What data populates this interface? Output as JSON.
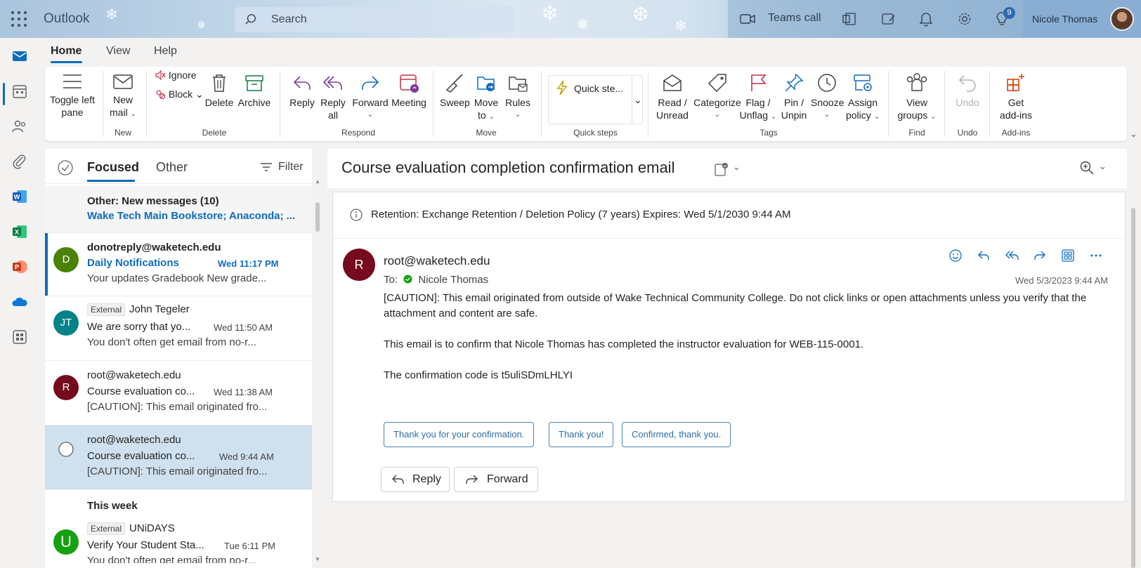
{
  "app": {
    "brand": "Outlook",
    "search_placeholder": "Search",
    "teams_call": "Teams call",
    "notification_count": "9",
    "user_name": "Nicole Thomas"
  },
  "tabs": [
    "Home",
    "View",
    "Help"
  ],
  "ribbon": {
    "toggle_left_pane": [
      "Toggle left",
      "pane"
    ],
    "new_mail": [
      "New",
      "mail"
    ],
    "ignore": "Ignore",
    "block": "Block",
    "delete": "Delete",
    "archive": "Archive",
    "reply": "Reply",
    "reply_all": [
      "Reply",
      "all"
    ],
    "forward": "Forward",
    "meeting": "Meeting",
    "sweep": "Sweep",
    "move_to": [
      "Move",
      "to"
    ],
    "rules": "Rules",
    "quick_steps": "Quick ste...",
    "read_unread": [
      "Read /",
      "Unread"
    ],
    "categorize": "Categorize",
    "flag_unflag": [
      "Flag /",
      "Unflag"
    ],
    "pin_unpin": [
      "Pin /",
      "Unpin"
    ],
    "snooze": "Snooze",
    "assign_policy": [
      "Assign",
      "policy"
    ],
    "view_groups": [
      "View",
      "groups"
    ],
    "undo": "Undo",
    "get_addins": [
      "Get",
      "add-ins"
    ],
    "groups": {
      "new": "New",
      "delete": "Delete",
      "respond": "Respond",
      "move": "Move",
      "quick_steps": "Quick steps",
      "tags": "Tags",
      "find": "Find",
      "undo": "Undo",
      "addins": "Add-ins"
    }
  },
  "list": {
    "focused": "Focused",
    "other": "Other",
    "filter": "Filter",
    "other_banner": {
      "title": "Other: New messages (10)",
      "senders": "Wake Tech Main Bookstore; Anaconda; ..."
    },
    "week_header": "This week",
    "items": [
      {
        "initials": "D",
        "sender": "donotreply@waketech.edu",
        "subject": "Daily Notifications",
        "time": "Wed 11:17 PM",
        "preview": "Your updates Gradebook New grade..."
      },
      {
        "initials": "JT",
        "external": "External",
        "sender": "John Tegeler",
        "subject": "We are sorry that yo...",
        "time": "Wed 11:50 AM",
        "preview": "You don't often get email from no-r..."
      },
      {
        "initials": "R",
        "sender": "root@waketech.edu",
        "subject": "Course evaluation co...",
        "time": "Wed 11:38 AM",
        "preview": "[CAUTION]: This email originated fro..."
      },
      {
        "initials": "",
        "sender": "root@waketech.edu",
        "subject": "Course evaluation co...",
        "time": "Wed 9:44 AM",
        "preview": "[CAUTION]: This email originated fro..."
      },
      {
        "initials": "U",
        "external": "External",
        "sender": "UNiDAYS",
        "subject": "Verify Your Student Sta...",
        "time": "Tue 6:11 PM",
        "preview": "You don't often get email from no-r..."
      }
    ]
  },
  "reading": {
    "subject": "Course evaluation completion confirmation email",
    "retention": "Retention: Exchange Retention / Deletion Policy (7 years) Expires: Wed 5/1/2030 9:44 AM",
    "avatar": "R",
    "sender": "root@waketech.edu",
    "to_label": "To:",
    "to_name": "Nicole Thomas",
    "date": "Wed 5/3/2023 9:44 AM",
    "body": [
      "[CAUTION]: This email originated from outside of Wake Technical Community College. Do not click links or open attachments unless you verify that the attachment and content are safe.",
      "This email is to confirm that Nicole Thomas has completed the instructor evaluation for WEB-115-0001.",
      "The confirmation code is t5uliSDmLHLYI"
    ],
    "quick_replies": [
      "Thank you for your confirmation.",
      "Thank you!",
      "Confirmed, thank you."
    ],
    "reply": "Reply",
    "forward": "Forward"
  },
  "colors": {
    "accent": "#0f6cbd",
    "avatar_d": "#498205",
    "avatar_jt": "#038387",
    "avatar_r": "#750b1c",
    "avatar_u": "#13a10e"
  }
}
